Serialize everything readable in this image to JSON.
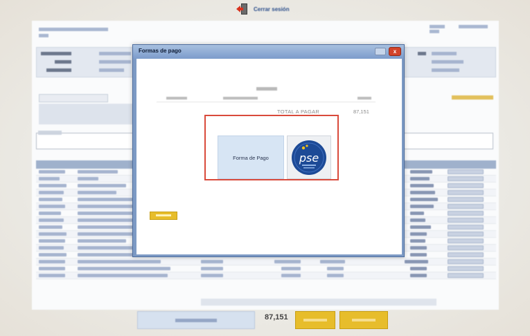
{
  "colors": {
    "accent_blue": "#3b5d9a",
    "modal_frame": "#7d9ac4",
    "highlight_red": "#d94a3b",
    "button_yellow": "#e7bd2b",
    "pse_blue": "#1d4a96"
  },
  "header": {
    "logout_label": "Cerrar sesión",
    "logout_icon": "exit-door-icon"
  },
  "modal": {
    "title": "Formas de pago",
    "close_symbol": "x",
    "pay_method_label": "Forma de Pago",
    "pse_logo_text": "pse",
    "total_label": "TOTAL A PAGAR",
    "total_value": "87,151"
  },
  "footer": {
    "total_value": "87,151"
  }
}
